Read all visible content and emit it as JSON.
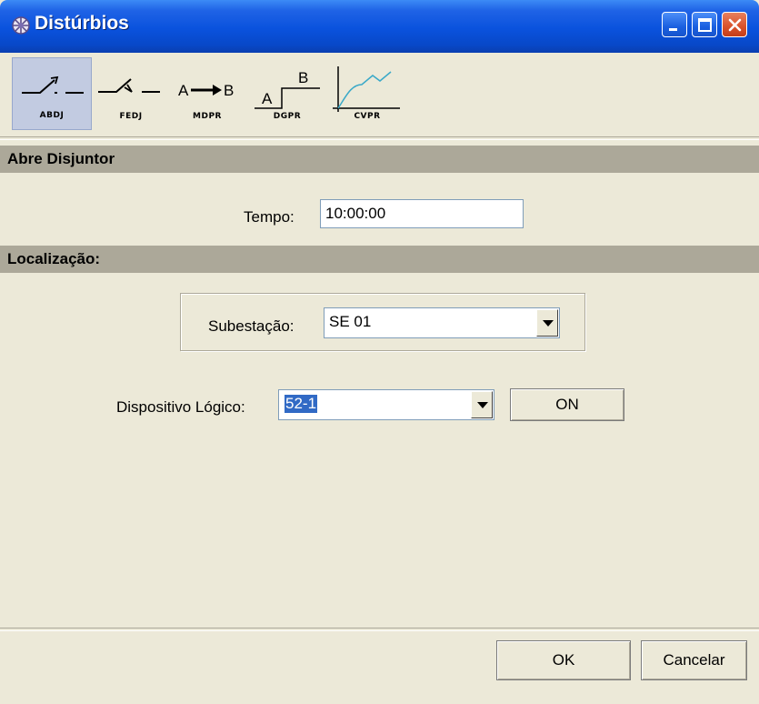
{
  "window": {
    "title": "Distúrbios"
  },
  "toolbar": {
    "items": [
      {
        "id": "ABDJ",
        "label": "ABDJ",
        "icon": "breaker-open-icon",
        "active": true
      },
      {
        "id": "FEDJ",
        "label": "FEDJ",
        "icon": "breaker-close-icon"
      },
      {
        "id": "MDPR",
        "label": "MDPR",
        "icon": "a-to-b-arrow-icon",
        "glyph_a": "A",
        "glyph_b": "B"
      },
      {
        "id": "DGPR",
        "label": "DGPR",
        "icon": "step-a-b-icon",
        "glyph_a": "A",
        "glyph_b": "B"
      },
      {
        "id": "CVPR",
        "label": "CVPR",
        "icon": "curve-chart-icon"
      }
    ]
  },
  "section1": {
    "title": "Abre Disjuntor"
  },
  "tempo": {
    "label": "Tempo:",
    "value": "10:00:00"
  },
  "section2": {
    "title": "Localização:"
  },
  "subestacao": {
    "label": "Subestação:",
    "selected": "SE 01"
  },
  "dispositivo": {
    "label": "Dispositivo Lógico:",
    "selected": "52-1",
    "toggle_label": "ON"
  },
  "footer": {
    "ok_label": "OK",
    "cancel_label": "Cancelar"
  },
  "colors": {
    "titlebar": "#0a52dd",
    "section_header": "#aca899",
    "background": "#ece9d8",
    "selection": "#316ac5"
  }
}
